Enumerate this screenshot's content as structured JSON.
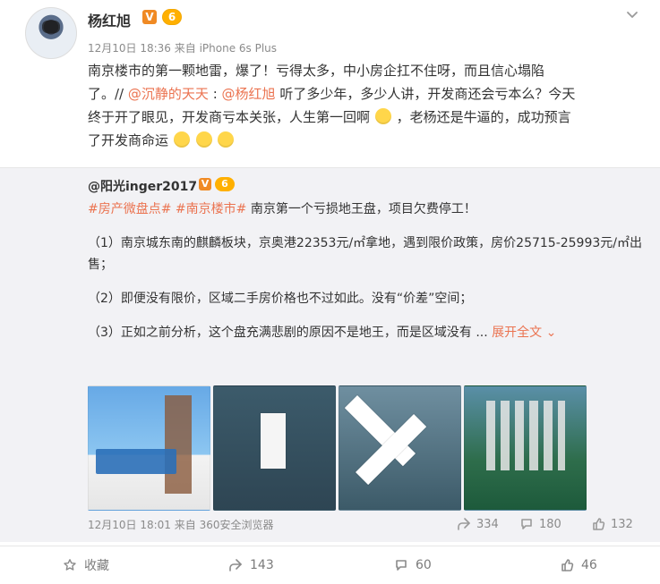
{
  "post": {
    "username": "杨红旭",
    "badge_v": "V",
    "badge_level": "6",
    "meta": "12月10日 18:36 来自 iPhone 6s Plus",
    "text": {
      "line1": "南京楼市的第一颗地雷，爆了！亏得太多，中小房企扛不住呀，而且信心塌陷",
      "line2_prefix": "了。//",
      "mention1": "@沉静的天天",
      "line2_mid": ":",
      "mention2": "@杨红旭",
      "line2_suffix": " 听了多少年，多少人讲，开发商还会亏本么？今天",
      "line3": "终于开了眼见，开发商亏本关张，人生第一回啊",
      "line3_suffix": "，老杨还是牛逼的，成功预言",
      "line4": "了开发商命运"
    },
    "more_icon": "chevron-down-icon"
  },
  "repost": {
    "username": "@阳光inger2017",
    "badge_v": "V",
    "badge_level": "6",
    "hashtag1": "#房产微盘点#",
    "hashtag2": "#南京楼市#",
    "headline": " 南京第一个亏损地王盘，项目欠费停工！",
    "p1": "（1）南京城东南的麒麟板块，京奥港22353元/㎡拿地，遇到限价政策，房价25715-25993元/㎡出售；",
    "p2": "（2）即便没有限价，区域二手房价格也不过如此。没有“价差”空间；",
    "p3_prefix": "（3）正如之前分析，这个盘充满悲剧的原因不是地王，而是区域没有 ...",
    "expand_label": "展开全文",
    "meta": "12月10日 18:01 来自 360安全浏览器",
    "actions": {
      "share": "334",
      "comment": "180",
      "like": "132"
    }
  },
  "bottom": {
    "fav": "收藏",
    "share": "143",
    "comment": "60",
    "like": "46"
  },
  "colors": {
    "accent": "#eb7350",
    "muted": "#8b8b8b"
  }
}
